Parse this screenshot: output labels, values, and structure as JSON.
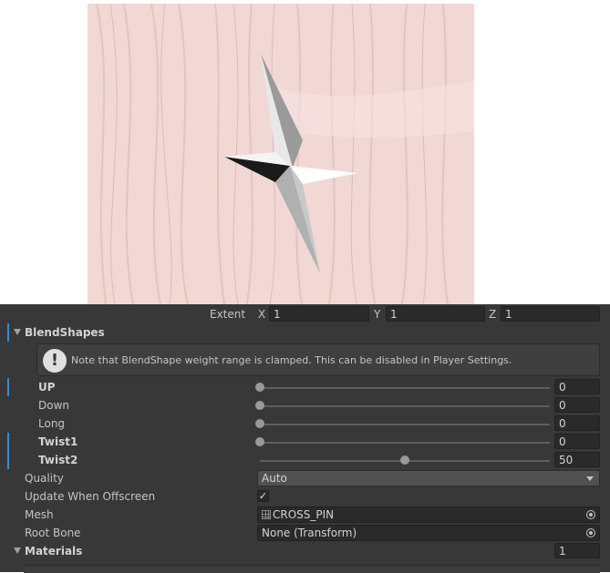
{
  "scene": {
    "object": "cross-pin",
    "background_color": "#f1d8d4"
  },
  "extent": {
    "label": "Extent",
    "x_axis": "X",
    "x": "1",
    "y_axis": "Y",
    "y": "1",
    "z_axis": "Z",
    "z": "1"
  },
  "blendshapes": {
    "title": "BlendShapes",
    "help_text": "Note that BlendShape weight range is clamped. This can be disabled in Player Settings.",
    "help_icon": "info-icon",
    "items": [
      {
        "label": "UP",
        "value": "0",
        "weight": 0,
        "modified": true
      },
      {
        "label": "Down",
        "value": "0",
        "weight": 0,
        "modified": false
      },
      {
        "label": "Long",
        "value": "0",
        "weight": 0,
        "modified": false
      },
      {
        "label": "Twist1",
        "value": "0",
        "weight": 0,
        "modified": true
      },
      {
        "label": "Twist2",
        "value": "50",
        "weight": 50,
        "modified": true
      }
    ]
  },
  "quality": {
    "label": "Quality",
    "value": "Auto"
  },
  "update_when_offscreen": {
    "label": "Update When Offscreen",
    "checked": true,
    "check_glyph": "✓"
  },
  "mesh": {
    "label": "Mesh",
    "value": "CROSS_PIN"
  },
  "root_bone": {
    "label": "Root Bone",
    "value": "None (Transform)"
  },
  "materials": {
    "label": "Materials",
    "count": "1"
  },
  "colors": {
    "inspector_bg": "#383838",
    "field_bg": "#2a2a2a",
    "accent": "#2d8fd8"
  }
}
